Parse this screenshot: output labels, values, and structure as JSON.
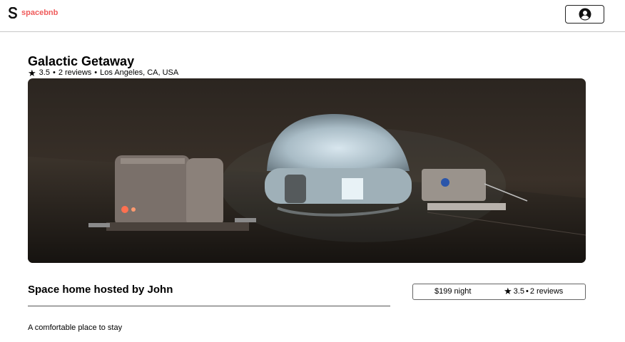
{
  "header": {
    "logo_letter": "S",
    "logo_text": "spacebnb",
    "brand_color": "#ef5b5b",
    "profile_icon": "user-circle-icon"
  },
  "listing": {
    "title": "Galactic Getaway",
    "star_icon": "★",
    "rating": "3.5",
    "separator": "•",
    "reviews": "2 reviews",
    "location": "Los Angeles, CA, USA",
    "image_alt": "Inflatable dome habitat with modules on the Martian surface at night"
  },
  "host": {
    "heading": "Space home hosted by John",
    "description": "A comfortable place to stay"
  },
  "booking": {
    "price": "$199 night",
    "star_icon": "★",
    "rating": "3.5",
    "separator": "•",
    "reviews": "2 reviews"
  }
}
